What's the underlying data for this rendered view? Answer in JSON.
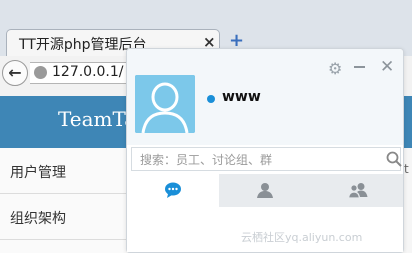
{
  "browser": {
    "tab_title": "TT开源php管理后台",
    "tab_close": "×",
    "new_tab": "+",
    "url": "127.0.0.1/"
  },
  "site": {
    "brand": "TeamTa",
    "nav": [
      {
        "label": "用户管理"
      },
      {
        "label": "组织架构"
      }
    ],
    "right_fragment": "t"
  },
  "chat": {
    "username": "www",
    "status_color": "#1a8fd8",
    "search_placeholder": "搜索：员工、讨论组、群",
    "tabs": [
      {
        "icon": "chat-bubble-icon",
        "active": true
      },
      {
        "icon": "contact-icon",
        "active": false
      },
      {
        "icon": "group-icon",
        "active": false
      }
    ],
    "accent_color": "#1a8fd8"
  },
  "watermark": "云栖社区yq.aliyun.com"
}
